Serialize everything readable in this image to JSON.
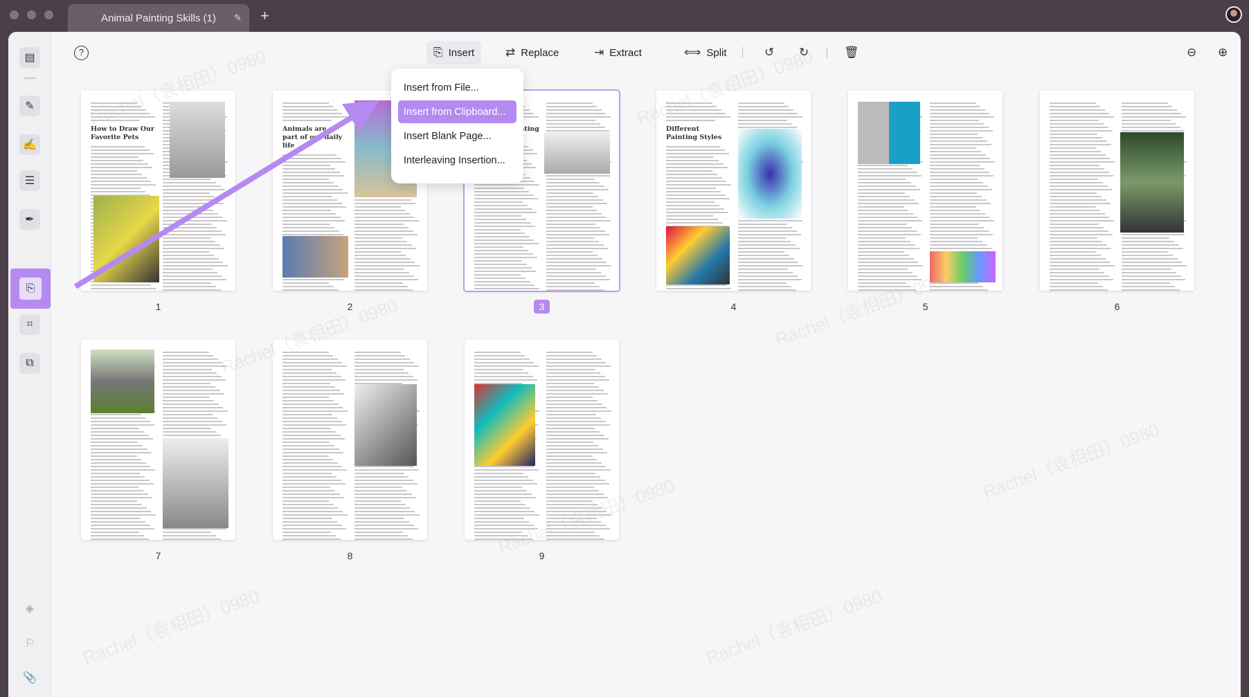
{
  "window": {
    "tab_title": "Animal Painting Skills (1)",
    "edit_icon": "pencil-icon",
    "new_tab_icon": "plus-icon"
  },
  "toolbar": {
    "help_icon": "question-circle-icon",
    "insert": "Insert",
    "replace": "Replace",
    "extract": "Extract",
    "split": "Split",
    "rotate_left_icon": "rotate-left-icon",
    "rotate_right_icon": "rotate-right-icon",
    "delete_icon": "trash-icon",
    "zoom_out_icon": "zoom-out-icon",
    "zoom_in_icon": "zoom-in-icon"
  },
  "insert_menu": {
    "items": [
      "Insert from File...",
      "Insert from Clipboard...",
      "Insert Blank Page...",
      "Interleaving Insertion..."
    ],
    "selected": 1
  },
  "pages": [
    {
      "number": "1",
      "titles": [
        "How to Draw Our Favorite Pets"
      ]
    },
    {
      "number": "2",
      "titles": [
        "Animals are a part of our daily life"
      ]
    },
    {
      "number": "3",
      "titles": [
        "Cute Pet Painting Steps"
      ],
      "selected": true
    },
    {
      "number": "4",
      "titles": [
        "Different Painting Styles"
      ]
    },
    {
      "number": "5",
      "titles": []
    },
    {
      "number": "6",
      "titles": []
    },
    {
      "number": "7",
      "titles": []
    },
    {
      "number": "8",
      "titles": []
    },
    {
      "number": "9",
      "titles": []
    }
  ],
  "watermark": "Rachel（袁相田）0980",
  "accent_color": "#b58af0"
}
